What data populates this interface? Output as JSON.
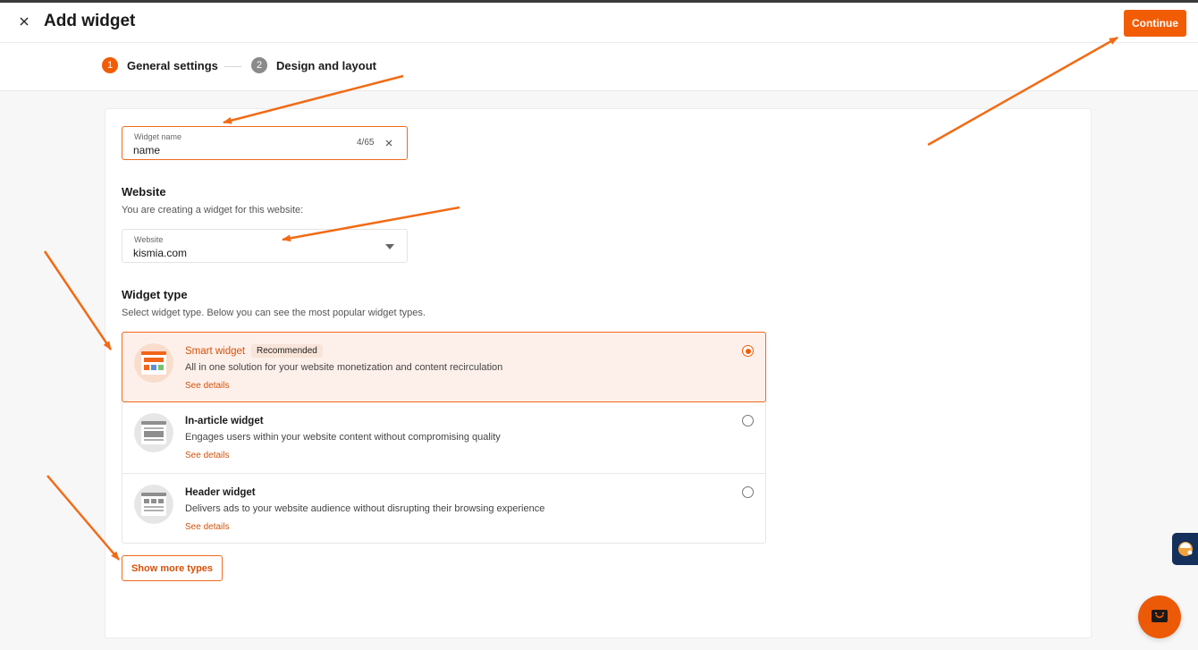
{
  "header": {
    "title": "Add widget",
    "close_icon": "close-icon",
    "continue_label": "Continue"
  },
  "steps": [
    {
      "number": "1",
      "label": "General settings",
      "state": "active"
    },
    {
      "number": "2",
      "label": "Design and layout",
      "state": "inactive"
    }
  ],
  "widget_name": {
    "label": "Widget name",
    "value": "name",
    "counter": "4/65",
    "clear_icon": "close-icon"
  },
  "website": {
    "title": "Website",
    "subtitle": "You are creating a widget for this website:",
    "field_label": "Website",
    "value": "kismia.com",
    "dropdown_icon": "caret-down-icon"
  },
  "widget_type": {
    "title": "Widget type",
    "subtitle": "Select widget type. Below you can see the most popular widget types.",
    "options": [
      {
        "name": "Smart widget",
        "badge": "Recommended",
        "description": "All in one solution for your website monetization and content recirculation",
        "details": "See details",
        "selected": true
      },
      {
        "name": "In-article widget",
        "badge": "",
        "description": "Engages users within your website content without compromising quality",
        "details": "See details",
        "selected": false
      },
      {
        "name": "Header widget",
        "badge": "",
        "description": "Delivers ads to your website audience without disrupting their browsing experience",
        "details": "See details",
        "selected": false
      }
    ],
    "more_label": "Show more types"
  },
  "floating": {
    "side_tab_icon": "assistant-icon",
    "chat_icon": "chat-icon"
  },
  "colors": {
    "accent": "#f25c05",
    "accent_text": "#d4520a",
    "selected_bg": "#fdf0ea",
    "arrow": "#f26a14"
  }
}
